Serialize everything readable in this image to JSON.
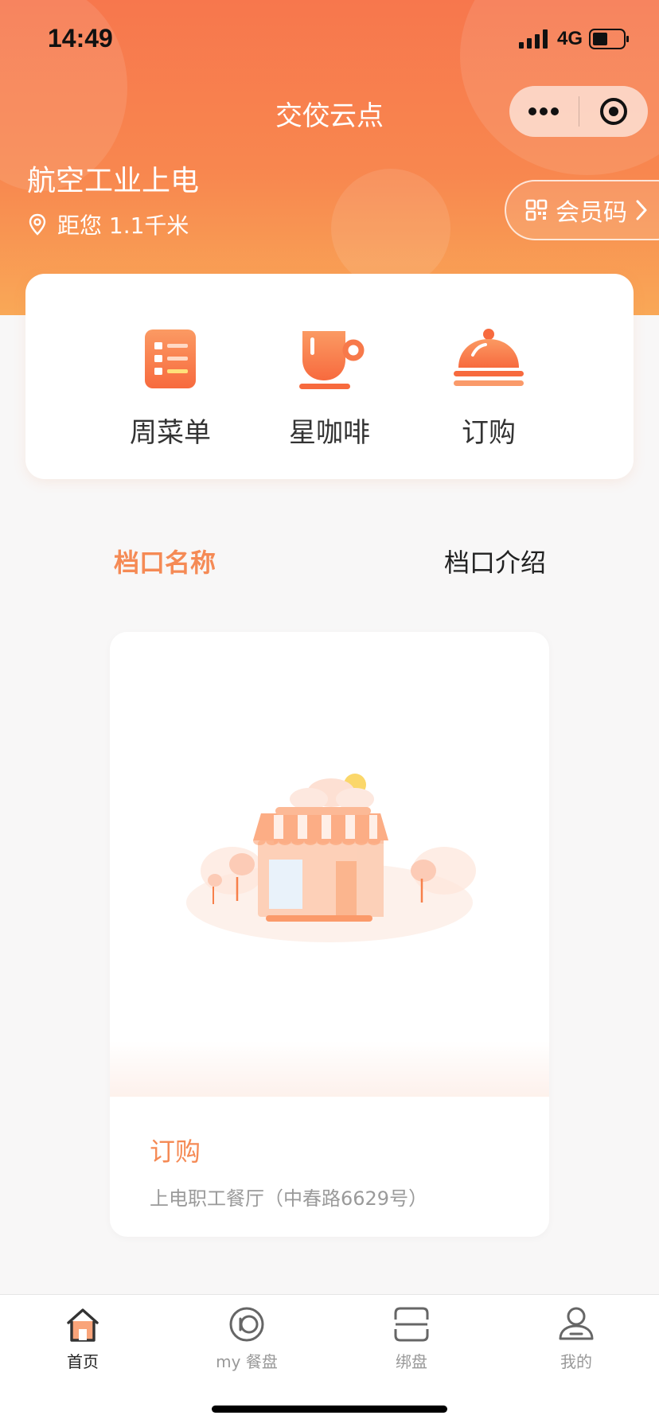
{
  "status_bar": {
    "time": "14:49",
    "network": "4G"
  },
  "header": {
    "title": "交佼云点",
    "store_name": "航空工业上电",
    "distance": "距您 1.1千米",
    "member_code": "会员码",
    "bg_colors": [
      "#f7774d",
      "#f9a857"
    ]
  },
  "quick_actions": [
    {
      "label": "周菜单",
      "icon": "menu-list-icon"
    },
    {
      "label": "星咖啡",
      "icon": "coffee-cup-icon"
    },
    {
      "label": "订购",
      "icon": "food-cloche-icon"
    }
  ],
  "tabs": [
    {
      "label": "档口名称",
      "active": true
    },
    {
      "label": "档口介绍",
      "active": false
    }
  ],
  "stall": {
    "name": "订购",
    "address": "上电职工餐厅（中春路6629号）",
    "image_icon": "storefront-illustration"
  },
  "tab_bar": [
    {
      "label": "首页",
      "icon": "home-icon",
      "active": true
    },
    {
      "label": "my 餐盘",
      "icon": "plate-icon",
      "active": false
    },
    {
      "label": "绑盘",
      "icon": "scan-bind-icon",
      "active": false
    },
    {
      "label": "我的",
      "icon": "user-icon",
      "active": false
    }
  ],
  "colors": {
    "accent": "#f58a55",
    "header_top": "#f7774d",
    "header_bottom": "#f9a857"
  }
}
